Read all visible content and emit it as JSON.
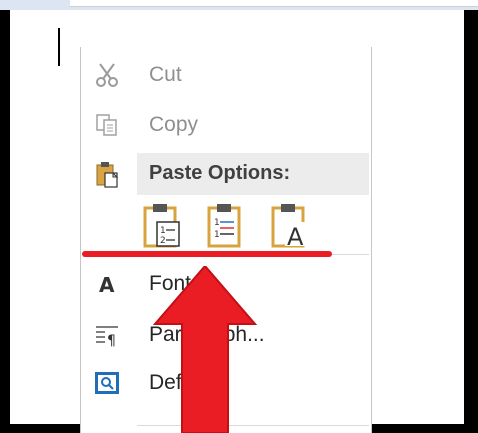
{
  "context_menu": {
    "items": [
      {
        "label": "Cut",
        "icon": "scissors-icon",
        "enabled": false
      },
      {
        "label": "Copy",
        "icon": "copy-icon",
        "enabled": false
      }
    ],
    "paste_header": "Paste Options:",
    "paste_options": [
      {
        "icon": "paste-keep-formatting-icon"
      },
      {
        "icon": "paste-merge-formatting-icon"
      },
      {
        "icon": "paste-text-only-icon"
      }
    ],
    "lower_items": [
      {
        "label": "Font...",
        "icon": "font-icon"
      },
      {
        "label": "Paragraph...",
        "icon": "paragraph-icon"
      },
      {
        "label": "Define",
        "icon": "define-icon"
      }
    ]
  },
  "annotation": {
    "color": "#ea1c24"
  }
}
